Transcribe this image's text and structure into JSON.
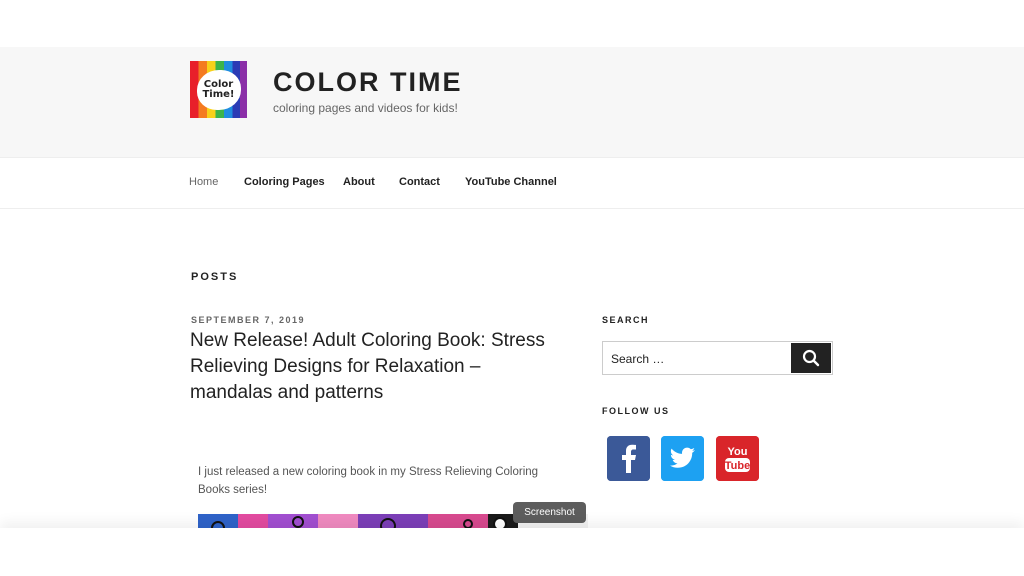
{
  "header": {
    "logo_text_line1": "Color",
    "logo_text_line2": "Time!",
    "site_title": "COLOR TIME",
    "site_description": "coloring pages and videos for kids!"
  },
  "nav": {
    "items": [
      {
        "label": "Home",
        "active": true
      },
      {
        "label": "Coloring Pages",
        "active": false
      },
      {
        "label": "About",
        "active": false
      },
      {
        "label": "Contact",
        "active": false
      },
      {
        "label": "YouTube Channel",
        "active": false
      }
    ]
  },
  "main": {
    "section_label": "POSTS",
    "post": {
      "date": "SEPTEMBER 7, 2019",
      "title": "New Release! Adult Coloring Book: Stress Relieving Designs for Relaxation – mandalas and patterns",
      "body": "I just released a new coloring book in my Stress Relieving Coloring Books series!"
    },
    "tooltip": "Screenshot"
  },
  "sidebar": {
    "search_title": "SEARCH",
    "search_placeholder": "Search …",
    "follow_title": "FOLLOW US",
    "social": [
      {
        "name": "facebook-icon",
        "color": "#3b5998"
      },
      {
        "name": "twitter-icon",
        "color": "#1da1f2"
      },
      {
        "name": "youtube-icon",
        "color": "#d9252a"
      }
    ]
  }
}
